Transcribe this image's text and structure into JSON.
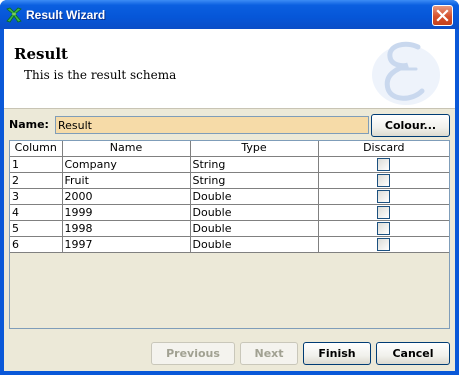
{
  "window": {
    "title": "Result Wizard"
  },
  "header": {
    "title": "Result",
    "subtitle": "This is the result schema"
  },
  "form": {
    "name_label": "Name:",
    "name_value": "Result",
    "colour_button": "Colour..."
  },
  "table": {
    "columns": [
      "Column",
      "Name",
      "Type",
      "Discard"
    ],
    "rows": [
      {
        "col": "1",
        "name": "Company",
        "type": "String",
        "discard": false
      },
      {
        "col": "2",
        "name": "Fruit",
        "type": "String",
        "discard": false
      },
      {
        "col": "3",
        "name": "2000",
        "type": "Double",
        "discard": false
      },
      {
        "col": "4",
        "name": "1999",
        "type": "Double",
        "discard": false
      },
      {
        "col": "5",
        "name": "1998",
        "type": "Double",
        "discard": false
      },
      {
        "col": "6",
        "name": "1997",
        "type": "Double",
        "discard": false
      }
    ]
  },
  "buttons": {
    "previous": "Previous",
    "next": "Next",
    "finish": "Finish",
    "cancel": "Cancel"
  },
  "icons": {
    "title_icon": "app-icon",
    "close": "close-icon",
    "logo": "wizard-logo-icon"
  }
}
